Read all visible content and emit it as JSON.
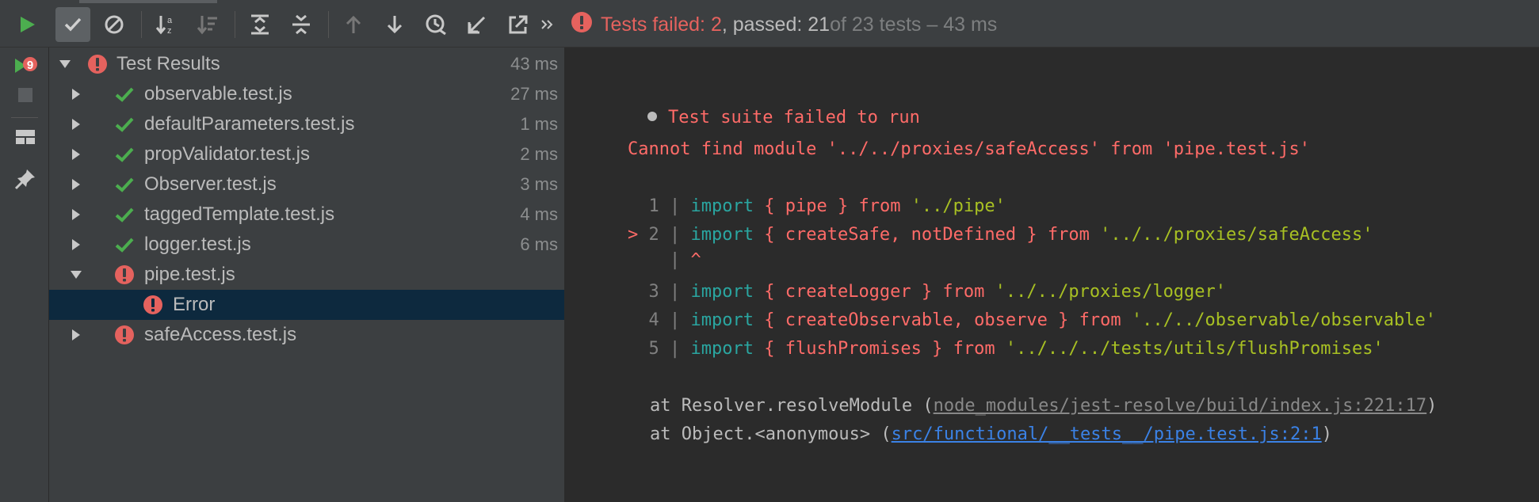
{
  "toolbar": {
    "buttons": [
      {
        "name": "run-icon"
      },
      {
        "name": "show-passed-icon",
        "active": true
      },
      {
        "name": "show-ignored-icon"
      },
      {
        "name": "sort-alpha-icon"
      },
      {
        "name": "sort-duration-icon"
      },
      {
        "name": "expand-all-icon"
      },
      {
        "name": "collapse-all-icon"
      },
      {
        "name": "previous-failed-icon"
      },
      {
        "name": "next-failed-icon"
      },
      {
        "name": "test-history-icon"
      },
      {
        "name": "import-tests-icon"
      },
      {
        "name": "export-tests-icon"
      },
      {
        "name": "more-chevron-icon"
      }
    ],
    "status": {
      "failed_text": "Tests failed: 2",
      "passed_text": ", passed: 21",
      "total_text": " of 23 tests – 43 ms"
    }
  },
  "leftbar": {
    "buttons": [
      "rerun-failed-icon",
      "stop-icon",
      "layout-icon",
      "pin-icon"
    ]
  },
  "tree": {
    "root": {
      "label": "Test Results",
      "duration": "43 ms",
      "status": "failed",
      "expanded": true
    },
    "items": [
      {
        "label": "observable.test.js",
        "duration": "27 ms",
        "status": "passed",
        "expanded": false
      },
      {
        "label": "defaultParameters.test.js",
        "duration": "1 ms",
        "status": "passed",
        "expanded": false
      },
      {
        "label": "propValidator.test.js",
        "duration": "2 ms",
        "status": "passed",
        "expanded": false
      },
      {
        "label": "Observer.test.js",
        "duration": "3 ms",
        "status": "passed",
        "expanded": false
      },
      {
        "label": "taggedTemplate.test.js",
        "duration": "4 ms",
        "status": "passed",
        "expanded": false
      },
      {
        "label": "logger.test.js",
        "duration": "6 ms",
        "status": "passed",
        "expanded": false
      },
      {
        "label": "pipe.test.js",
        "duration": "",
        "status": "failed",
        "expanded": true
      },
      {
        "label": "Error",
        "duration": "",
        "status": "failed",
        "selected": true
      },
      {
        "label": "safeAccess.test.js",
        "duration": "",
        "status": "failed",
        "expanded": false
      }
    ]
  },
  "console": {
    "header": "Test suite failed to run",
    "message": "Cannot find module '../../proxies/safeAccess' from 'pipe.test.js'",
    "code": [
      {
        "num": "1",
        "marker": "",
        "kw": "import",
        "names": "{ pipe }",
        "from": "from",
        "path": "'../pipe'"
      },
      {
        "num": "2",
        "marker": ">",
        "kw": "import",
        "names": "{ createSafe, notDefined }",
        "from": "from",
        "path": "'../../proxies/safeAccess'"
      },
      {
        "num": "3",
        "marker": "",
        "kw": "import",
        "names": "{ createLogger }",
        "from": "from",
        "path": "'../../proxies/logger'"
      },
      {
        "num": "4",
        "marker": "",
        "kw": "import",
        "names": "{ createObservable, observe }",
        "from": "from",
        "path": "'../../observable/observable'"
      },
      {
        "num": "5",
        "marker": "",
        "kw": "import",
        "names": "{ flushPromises }",
        "from": "from",
        "path": "'../../../tests/utils/flushPromises'"
      }
    ],
    "caret": "^",
    "stack": [
      {
        "prefix": "at Resolver.resolveModule (",
        "link": "node_modules/jest-resolve/build/index.js:221:17",
        "suffix": ")"
      },
      {
        "prefix": "at Object.<anonymous> (",
        "link": "src/functional/__tests__/pipe.test.js:2:1",
        "suffix": ")"
      }
    ]
  },
  "colors": {
    "failed": "#e5625e",
    "passed": "#4cae4f",
    "keyword": "#2aa6a1",
    "string": "#a8c023",
    "error_text": "#ff6b68",
    "link": "#3b82e6",
    "selection": "#0d293e"
  }
}
